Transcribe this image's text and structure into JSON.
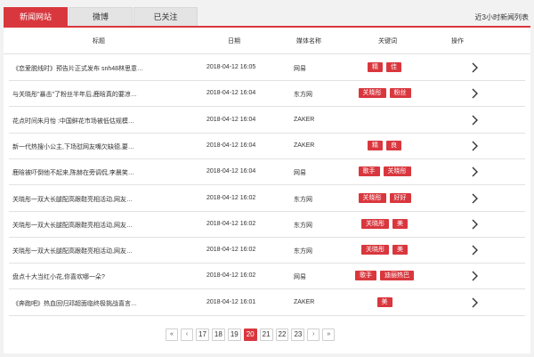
{
  "tabs": [
    "新闻网站",
    "微博",
    "已关注"
  ],
  "caption": "近3小时新闻列表",
  "columns": {
    "title": "标题",
    "date": "日期",
    "media": "媒体名称",
    "keywords": "关键词",
    "action": "操作"
  },
  "rows": [
    {
      "title": "《恋爱脱线时》预告片正式发布 snh48林思意…",
      "date": "2018-04-12 16:05",
      "media": "网易",
      "keywords": [
        "精",
        "佳"
      ]
    },
    {
      "title": "与关晓彤\"暴击\"了粉丝半年后,鹿晗真的要凉…",
      "date": "2018-04-12 16:04",
      "media": "东方网",
      "keywords": [
        "关晓彤",
        "粉丝"
      ]
    },
    {
      "title": "花点时间朱月怡 :中国鲜花市场被低估规模…",
      "date": "2018-04-12 16:04",
      "media": "ZAKER",
      "keywords": []
    },
    {
      "title": "新一代热搜小公主,下场怼网友嘴欠缺德,要…",
      "date": "2018-04-12 16:04",
      "media": "ZAKER",
      "keywords": [
        "精",
        "良"
      ]
    },
    {
      "title": "鹿晗被吓倒他不起来,陈赫在旁调侃,李晨笑…",
      "date": "2018-04-12 16:04",
      "media": "网易",
      "keywords": [
        "歌手",
        "关晓彤"
      ]
    },
    {
      "title": "关晓彤一双大长腿配高跟鞋亮相活动,网友…",
      "date": "2018-04-12 16:02",
      "media": "东方网",
      "keywords": [
        "关晓彤",
        "好好"
      ]
    },
    {
      "title": "关晓彤一双大长腿配高跟鞋亮相活动,网友…",
      "date": "2018-04-12 16:02",
      "media": "东方网",
      "keywords": [
        "关晓彤",
        "美"
      ]
    },
    {
      "title": "关晓彤一双大长腿配高跟鞋亮相活动,网友…",
      "date": "2018-04-12 16:02",
      "media": "东方网",
      "keywords": [
        "关晓彤",
        "美"
      ]
    },
    {
      "title": "盘点十大当红小花,你喜欢哪一朵?",
      "date": "2018-04-12 16:02",
      "media": "网易",
      "keywords": [
        "歌手",
        "迪丽热巴"
      ]
    },
    {
      "title": "《奔跑吧》热血回归邓超面临终极挑战喜言…",
      "date": "2018-04-12 16:01",
      "media": "ZAKER",
      "keywords": [
        "美"
      ]
    }
  ],
  "pagination": {
    "first": "«",
    "prev": "‹",
    "pages": [
      "17",
      "18",
      "19",
      "20",
      "21",
      "22",
      "23"
    ],
    "current": "20",
    "next": "›",
    "last": "»"
  },
  "colors": {
    "accent": "#d9373e"
  },
  "icons": {
    "row_action": "chevron-right-icon"
  }
}
